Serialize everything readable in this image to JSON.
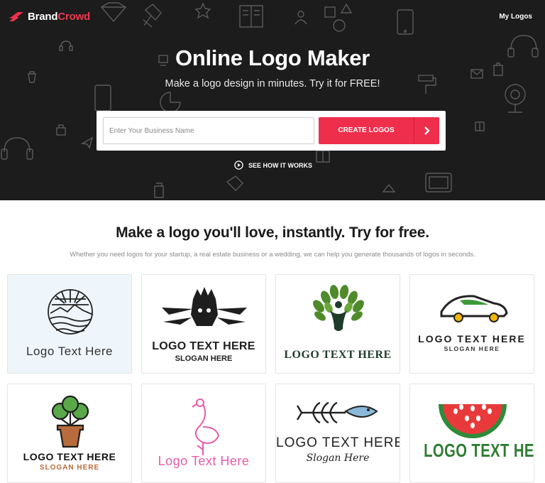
{
  "brand": {
    "name_part1": "Brand",
    "name_part2": "Crowd"
  },
  "nav": {
    "my_logos": "My Logos"
  },
  "hero": {
    "title": "Online Logo Maker",
    "subtitle": "Make a logo design in minutes. Try it for FREE!",
    "input_placeholder": "Enter Your Business Name",
    "create_button": "CREATE LOGOS",
    "see_how": "SEE HOW IT WORKS"
  },
  "section": {
    "title": "Make a logo you'll love, instantly. Try for free.",
    "subtitle": "Whether you need logos for your startup, a real estate business or a wedding, we can help you generate thousands of logos in seconds."
  },
  "logos": [
    {
      "text": "Logo Text Here",
      "slogan": ""
    },
    {
      "text": "LOGO TEXT HERE",
      "slogan": "SLOGAN HERE"
    },
    {
      "text": "LOGO TEXT HERE",
      "slogan": ""
    },
    {
      "text": "LOGO TEXT HERE",
      "slogan": "SLOGAN HERE"
    },
    {
      "text": "LOGO TEXT HERE",
      "slogan": "SLOGAN HERE"
    },
    {
      "text": "Logo Text Here",
      "slogan": ""
    },
    {
      "text": "LOGO TEXT HERE",
      "slogan": "Slogan Here"
    },
    {
      "text": "LOGO TEXT HERE",
      "slogan": ""
    }
  ],
  "colors": {
    "accent": "#ef2e4c",
    "hero_bg": "#1c1c1c"
  }
}
